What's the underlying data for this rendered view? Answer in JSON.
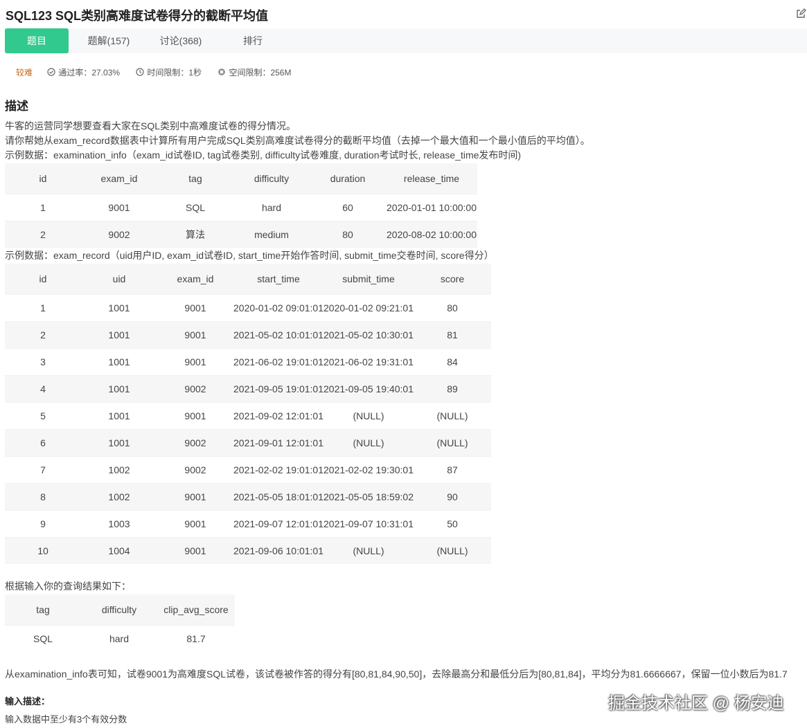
{
  "header": {
    "title": "SQL123  SQL类别高难度试卷得分的截断平均值"
  },
  "tabs": [
    {
      "label": "题目",
      "active": true
    },
    {
      "label": "题解(157)",
      "active": false
    },
    {
      "label": "讨论(368)",
      "active": false
    },
    {
      "label": "排行",
      "active": false
    }
  ],
  "meta": {
    "difficulty": "较难",
    "pass_rate": "通过率：27.03%",
    "time_limit": "时间限制：1秒",
    "memory_limit": "空间限制：256M"
  },
  "description": {
    "heading": "描述",
    "line1": "牛客的运营同学想要查看大家在SQL类别中高难度试卷的得分情况。",
    "line2": "请你帮她从exam_record数据表中计算所有用户完成SQL类别高难度试卷得分的截断平均值（去掉一个最大值和一个最小值后的平均值）。",
    "example1_caption": "示例数据：examination_info（exam_id试卷ID, tag试卷类别, difficulty试卷难度, duration考试时长, release_time发布时间)",
    "example2_caption": "示例数据：exam_record（uid用户ID, exam_id试卷ID, start_time开始作答时间, submit_time交卷时间, score得分）",
    "result_caption": "根据输入你的查询结果如下：",
    "explanation": "从examination_info表可知，试卷9001为高难度SQL试卷，该试卷被作答的得分有[80,81,84,90,50]，去除最高分和最低分后为[80,81,84]，平均分为81.6666667，保留一位小数后为81.7",
    "input_desc_label": "输入描述：",
    "input_desc": "输入数据中至少有3个有效分数"
  },
  "examination_info": {
    "columns": [
      "id",
      "exam_id",
      "tag",
      "difficulty",
      "duration",
      "release_time"
    ],
    "rows": [
      [
        "1",
        "9001",
        "SQL",
        "hard",
        "60",
        "2020-01-01 10:00:00"
      ],
      [
        "2",
        "9002",
        "算法",
        "medium",
        "80",
        "2020-08-02 10:00:00"
      ]
    ]
  },
  "exam_record": {
    "columns": [
      "id",
      "uid",
      "exam_id",
      "start_time",
      "submit_time",
      "score"
    ],
    "rows": [
      [
        "1",
        "1001",
        "9001",
        "2020-01-02 09:01:01",
        "2020-01-02 09:21:01",
        "80"
      ],
      [
        "2",
        "1001",
        "9001",
        "2021-05-02 10:01:01",
        "2021-05-02 10:30:01",
        "81"
      ],
      [
        "3",
        "1001",
        "9001",
        "2021-06-02 19:01:01",
        "2021-06-02 19:31:01",
        "84"
      ],
      [
        "4",
        "1001",
        "9002",
        "2021-09-05 19:01:01",
        "2021-09-05 19:40:01",
        "89"
      ],
      [
        "5",
        "1001",
        "9001",
        "2021-09-02 12:01:01",
        "(NULL)",
        "(NULL)"
      ],
      [
        "6",
        "1001",
        "9002",
        "2021-09-01 12:01:01",
        "(NULL)",
        "(NULL)"
      ],
      [
        "7",
        "1002",
        "9002",
        "2021-02-02 19:01:01",
        "2021-02-02 19:30:01",
        "87"
      ],
      [
        "8",
        "1002",
        "9001",
        "2021-05-05 18:01:01",
        "2021-05-05 18:59:02",
        "90"
      ],
      [
        "9",
        "1003",
        "9001",
        "2021-09-07 12:01:01",
        "2021-09-07 10:31:01",
        "50"
      ],
      [
        "10",
        "1004",
        "9001",
        "2021-09-06 10:01:01",
        "(NULL)",
        "(NULL)"
      ]
    ]
  },
  "result": {
    "columns": [
      "tag",
      "difficulty",
      "clip_avg_score"
    ],
    "rows": [
      [
        "SQL",
        "hard",
        "81.7"
      ]
    ]
  },
  "watermark": "掘金技术社区 @ 杨安迪",
  "colors": {
    "accent": "#32c98e",
    "difficulty": "#c26b1c"
  }
}
